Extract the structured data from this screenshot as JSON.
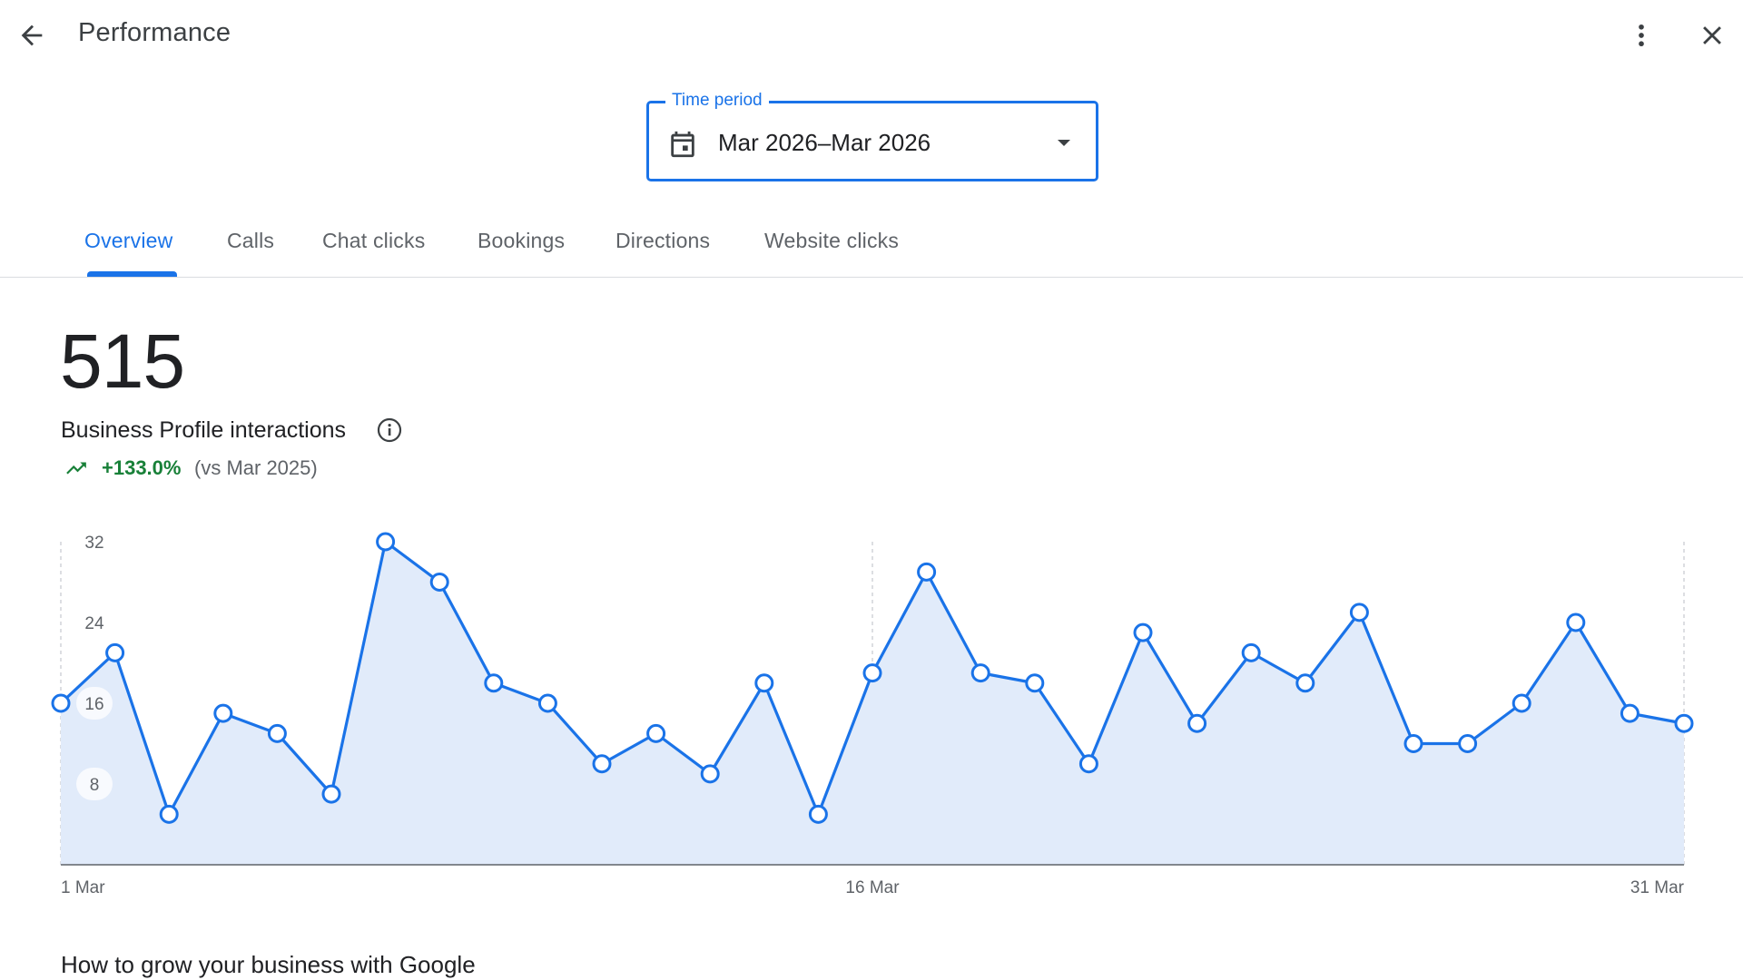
{
  "header": {
    "title": "Performance",
    "back_icon": "arrow-back-icon",
    "more_icon": "more-vert-icon",
    "close_icon": "close-icon"
  },
  "time_period": {
    "label": "Time period",
    "value": "Mar 2026–Mar 2026",
    "icon": "calendar-icon"
  },
  "tabs": [
    {
      "label": "Overview",
      "active": true
    },
    {
      "label": "Calls",
      "active": false
    },
    {
      "label": "Chat clicks",
      "active": false
    },
    {
      "label": "Bookings",
      "active": false
    },
    {
      "label": "Directions",
      "active": false
    },
    {
      "label": "Website clicks",
      "active": false
    }
  ],
  "summary": {
    "total": "515",
    "label": "Business Profile interactions",
    "change": "+133.0%",
    "compare": "(vs Mar 2025)",
    "change_color": "#188038"
  },
  "colors": {
    "accent": "#1a73e8",
    "area_fill": "#e1ebfa"
  },
  "chart_data": {
    "type": "area",
    "x": [
      "1 Mar",
      "2 Mar",
      "3 Mar",
      "4 Mar",
      "5 Mar",
      "6 Mar",
      "7 Mar",
      "8 Mar",
      "9 Mar",
      "10 Mar",
      "11 Mar",
      "12 Mar",
      "13 Mar",
      "14 Mar",
      "15 Mar",
      "16 Mar",
      "17 Mar",
      "18 Mar",
      "19 Mar",
      "20 Mar",
      "21 Mar",
      "22 Mar",
      "23 Mar",
      "24 Mar",
      "25 Mar",
      "26 Mar",
      "27 Mar",
      "28 Mar",
      "29 Mar",
      "30 Mar",
      "31 Mar"
    ],
    "x_tick_labels": [
      "1 Mar",
      "16 Mar",
      "31 Mar"
    ],
    "y_ticks": [
      "8",
      "16",
      "24",
      "32"
    ],
    "ylim": [
      0,
      32
    ],
    "series": [
      {
        "values": [
          16,
          21,
          5,
          15,
          13,
          7,
          32,
          28,
          18,
          16,
          10,
          13,
          9,
          18,
          5,
          19,
          29,
          19,
          18,
          10,
          23,
          14,
          21,
          18,
          25,
          12,
          12,
          16,
          24,
          15,
          14
        ]
      }
    ]
  },
  "footer": {
    "heading": "How to grow your business with Google"
  }
}
